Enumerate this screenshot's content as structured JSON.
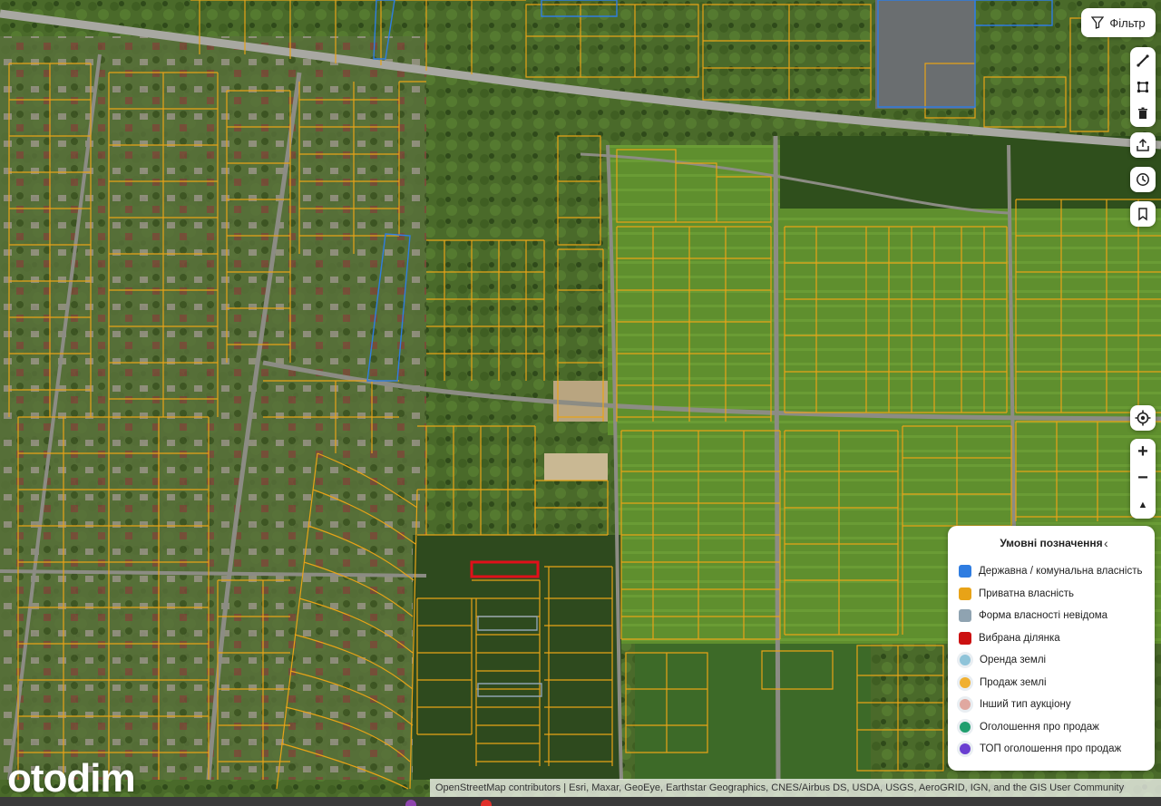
{
  "filter": {
    "label": "Фільтр"
  },
  "tools": {
    "draw_line_icon": "pencil-icon",
    "polygon_icon": "polygon-icon",
    "delete_icon": "trash-icon",
    "share_icon": "share-icon",
    "history_icon": "clock-icon",
    "bookmark_icon": "bookmark-icon",
    "locate_icon": "locate-icon",
    "zoom_in": "+",
    "zoom_out": "−",
    "compass": "▲"
  },
  "legend": {
    "title": "Умовні позначення",
    "items": [
      {
        "label": "Державна / комунальна власність",
        "color": "#2f7de1",
        "kind": "square"
      },
      {
        "label": "Приватна власність",
        "color": "#e8a317",
        "kind": "square"
      },
      {
        "label": "Форма власності невідома",
        "color": "#8fa3b1",
        "kind": "square"
      },
      {
        "label": "Вибрана ділянка",
        "color": "#cc1111",
        "kind": "square"
      },
      {
        "label": "Оренда землі",
        "color": "#8fc4d9",
        "kind": "circle"
      },
      {
        "label": "Продаж землі",
        "color": "#f0b030",
        "kind": "circle"
      },
      {
        "label": "Інший тип аукціону",
        "color": "#e0a8a0",
        "kind": "circle"
      },
      {
        "label": "Оголошення про продаж",
        "color": "#1f9e6e",
        "kind": "circle"
      },
      {
        "label": "ТОП оголошення про продаж",
        "color": "#6a3fd1",
        "kind": "circle"
      }
    ]
  },
  "attribution": "OpenStreetMap contributors | Esri, Maxar, GeoEye, Earthstar Geographics, CNES/Airbus DS, USDA, USGS, AeroGRID, IGN, and the GIS User Community",
  "logo": "otodim",
  "colors": {
    "parcel_private": "#e8a317",
    "parcel_state": "#2f7de1",
    "parcel_unknown": "#8fa3b1",
    "selected": "#e0101a"
  }
}
